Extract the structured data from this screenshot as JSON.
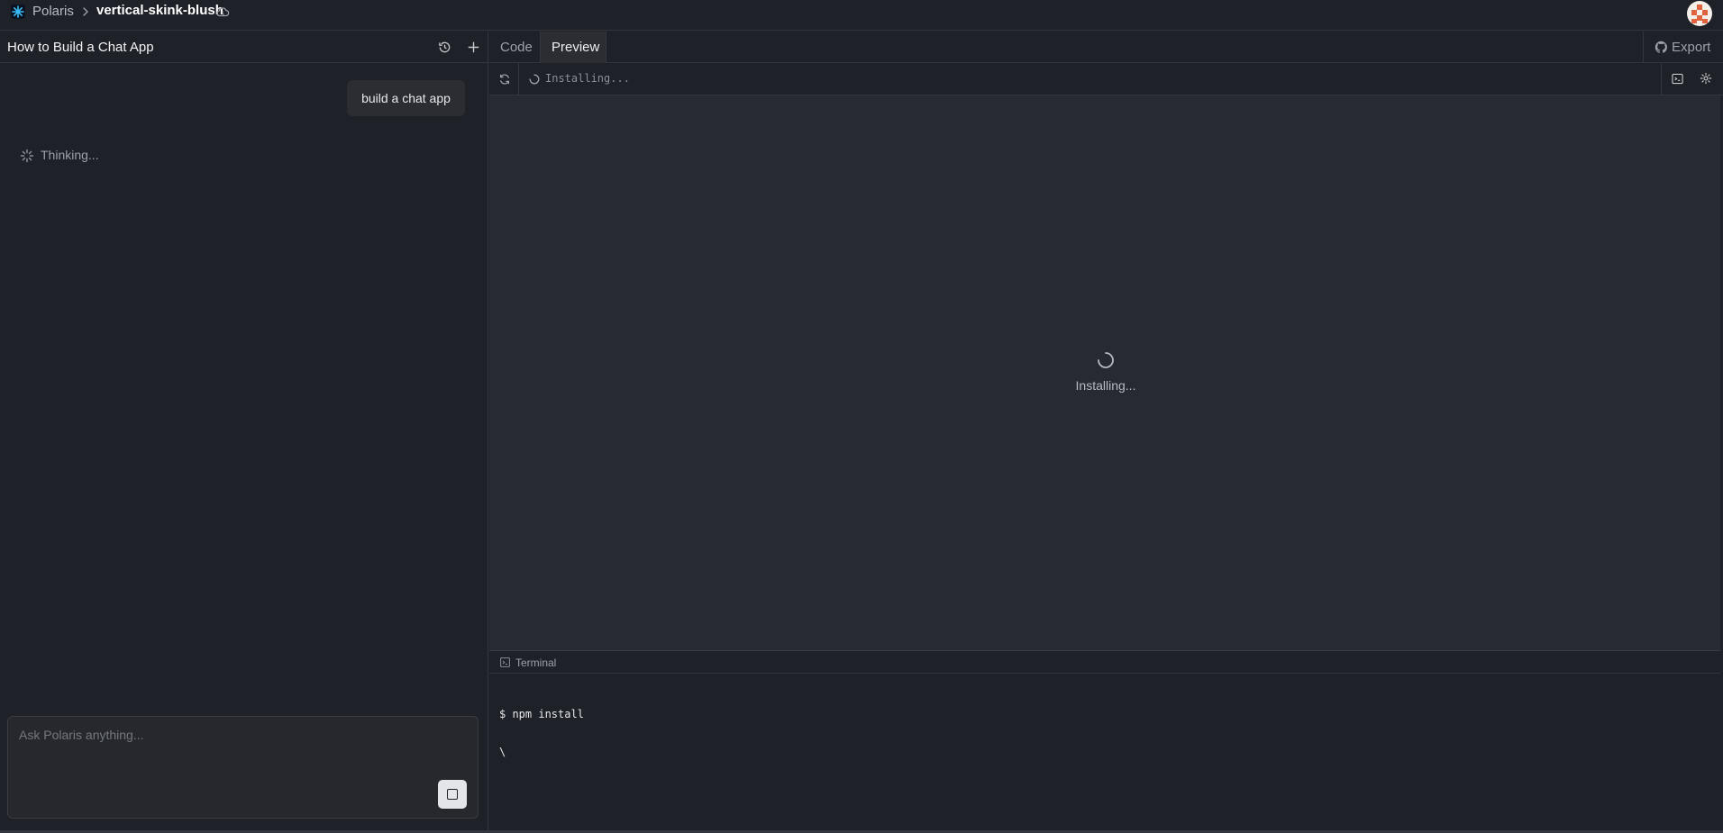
{
  "topbar": {
    "app_name": "Polaris",
    "project_name": "vertical-skink-blush"
  },
  "chat": {
    "title": "How to Build a Chat App",
    "user_message": "build a chat app",
    "status": "Thinking...",
    "input_placeholder": "Ask Polaris anything..."
  },
  "workspace": {
    "tabs": [
      {
        "label": "Code",
        "active": false
      },
      {
        "label": "Preview",
        "active": true
      }
    ],
    "export_label": "Export",
    "address_status": "Installing...",
    "preview_status": "Installing..."
  },
  "terminal": {
    "title": "Terminal",
    "lines": [
      "$ npm install",
      "\\"
    ]
  },
  "colors": {
    "background": "#1f2128",
    "preview_background": "#282a32",
    "accent_logo": "#38bdf8"
  }
}
